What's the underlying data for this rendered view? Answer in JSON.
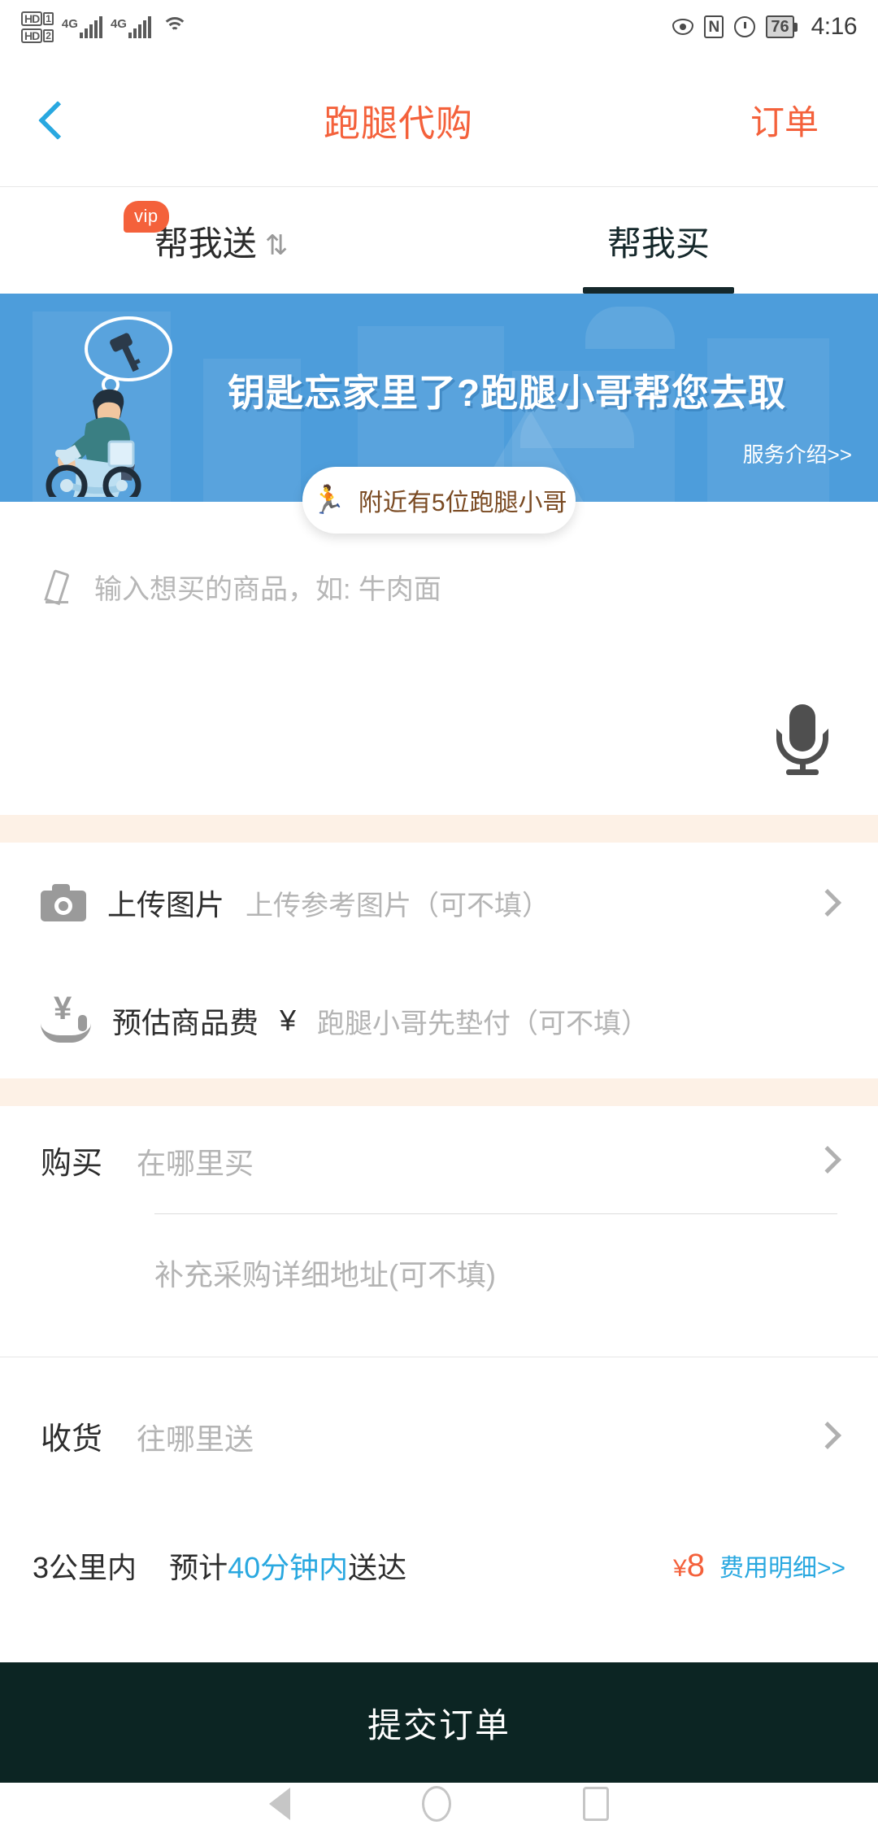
{
  "statusbar": {
    "hd1_label": "HD",
    "hd1_num": "1",
    "hd2_label": "HD",
    "hd2_num": "2",
    "net1": "4G",
    "net2": "4G",
    "nfc": "N",
    "battery": "76",
    "time": "4:16",
    "icons": [
      "eye-icon",
      "nfc-icon",
      "alarm-icon",
      "battery-icon",
      "wifi-icon",
      "signal-icon"
    ]
  },
  "header": {
    "back": "back-chevron",
    "title": "跑腿代购",
    "action": "订单",
    "title_color": "#f4613b"
  },
  "tabs": [
    {
      "label": "帮我送",
      "badge": "vip",
      "has_sort_icon": true,
      "active": false
    },
    {
      "label": "帮我买",
      "badge": "",
      "has_sort_icon": false,
      "active": true
    }
  ],
  "banner": {
    "text": "钥匙忘家里了?跑腿小哥帮您去取",
    "service_link": "服务介绍>>",
    "bg_color": "#4d9ddb",
    "illustration": "scooter-rider-with-key-thought-bubble"
  },
  "rider_pill": {
    "icon": "running-person-icon",
    "text": "附近有5位跑腿小哥"
  },
  "item_input": {
    "icon": "pencil-icon",
    "placeholder": "输入想买的商品，如: 牛肉面",
    "value": "",
    "mic": "microphone-icon"
  },
  "upload_row": {
    "icon": "camera-icon",
    "label": "上传图片",
    "placeholder": "上传参考图片（可不填）",
    "chevron": "chevron-right-icon"
  },
  "fee_row": {
    "icon": "yen-in-hand-icon",
    "label": "预估商品费",
    "currency": "¥",
    "placeholder": "跑腿小哥先垫付（可不填）",
    "value": ""
  },
  "buy_section": {
    "label": "购买",
    "placeholder": "在哪里买",
    "value": "",
    "detail_placeholder": "补充采购详细地址(可不填)",
    "detail_value": "",
    "chevron": "chevron-right-icon"
  },
  "deliver_section": {
    "label": "收货",
    "placeholder": "往哪里送",
    "value": "",
    "chevron": "chevron-right-icon"
  },
  "estimate": {
    "distance": "3公里内",
    "prefix": "预计",
    "duration": "40分钟内",
    "suffix": "送达",
    "currency": "¥",
    "amount": "8",
    "detail_link": "费用明细>>",
    "duration_color": "#29a8e0",
    "amount_color": "#f4613b"
  },
  "submit": {
    "label": "提交订单",
    "bg_color": "#0c2523"
  },
  "navbar": {
    "back": "nav-back-icon",
    "home": "nav-home-icon",
    "recents": "nav-recents-icon"
  }
}
